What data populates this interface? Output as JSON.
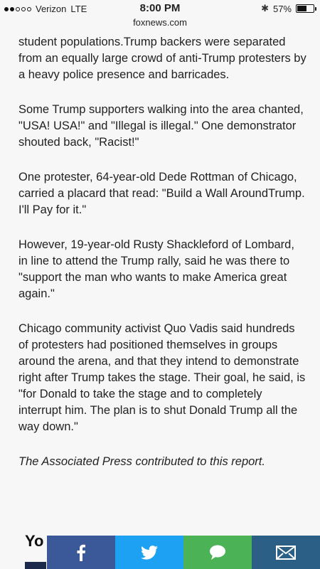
{
  "status_bar": {
    "carrier": "Verizon",
    "network": "LTE",
    "time": "8:00 PM",
    "url": "foxnews.com",
    "battery_percent_label": "57%",
    "battery_level": 0.57,
    "signal_bars_filled": 2,
    "signal_bars_total": 5
  },
  "article": {
    "paragraphs": [
      "student populations.Trump backers were separated from an equally large crowd of anti-Trump protesters by a heavy police presence and barricades.",
      "Some Trump supporters walking into the area chanted, \"USA! USA!\" and \"Illegal is illegal.\" One demonstrator shouted back, \"Racist!\"",
      "One protester, 64-year-old Dede Rottman of Chicago, carried a placard that read: \"Build a Wall AroundTrump. I'll Pay for it.\"",
      "However, 19-year-old Rusty Shackleford of Lombard, in line to attend the Trump rally, said he was there to \"support the man who wants to make America great again.\"",
      "Chicago community activist Quo Vadis said hundreds of protesters had positioned themselves in groups around the arena, and that they intend to demonstrate right after Trump takes the stage. Their goal, he said, is \"for Donald to take the stage and to completely interrupt him. The plan is to shut Donald Trump all the way down.\""
    ],
    "credit": "The Associated Press contributed to this report."
  },
  "promo": {
    "partial_heading": "Yo"
  },
  "share_bar": {
    "colors": {
      "facebook": "#3b5998",
      "twitter": "#1da1f2",
      "sms": "#4bb355",
      "email": "#2b5f86"
    },
    "icons": [
      "facebook-icon",
      "twitter-icon",
      "sms-icon",
      "email-icon"
    ]
  }
}
